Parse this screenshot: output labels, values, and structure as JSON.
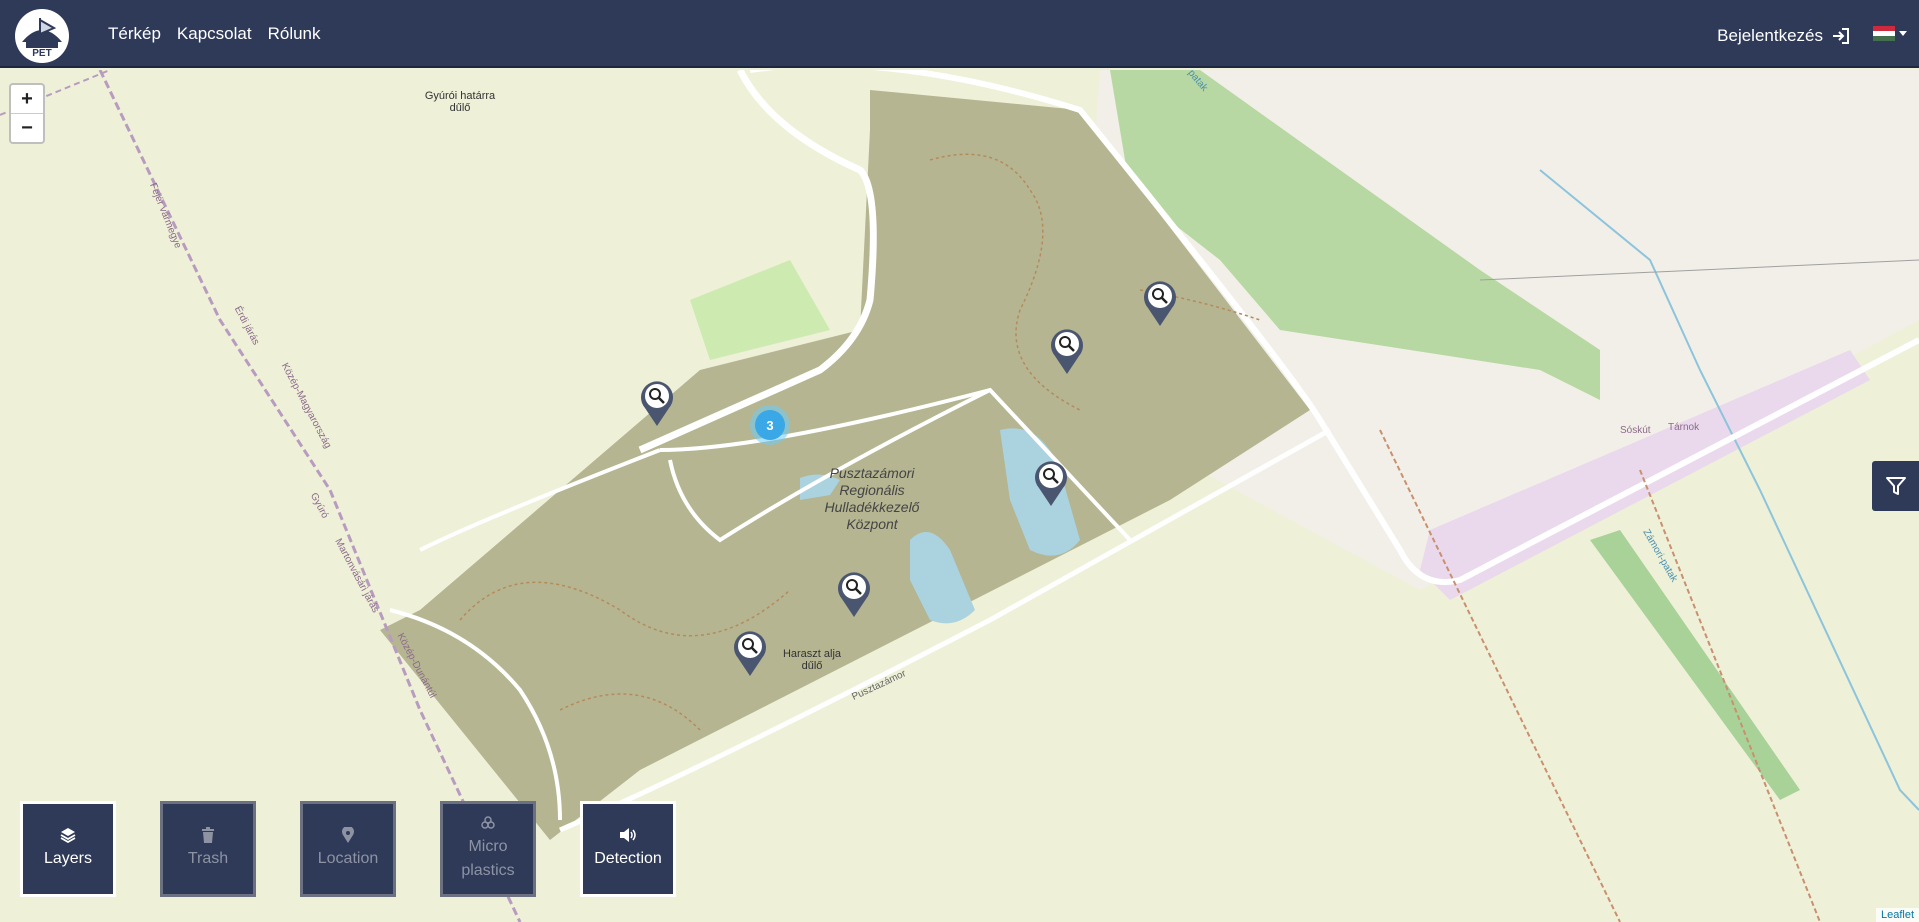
{
  "navbar": {
    "links": [
      "Térkép",
      "Kapcsolat",
      "Rólunk"
    ],
    "login_label": "Bejelentkezés",
    "language_flag": "hungarian-flag-icon",
    "bg_color": "#2e3a58"
  },
  "map": {
    "zoom_in": "+",
    "zoom_out": "−",
    "cluster_count": "3",
    "labels": {
      "gyuroi": "Gyúrói határra dűlő",
      "center": "Pusztazámori Regionális Hulladékkezelő Központ",
      "haraszt": "Haraszt alja dűlő",
      "soskut": "Sóskút",
      "tarnok": "Tárnok",
      "zamori_patak": "Zámori-patak",
      "pusztazamor": "Pusztazámor",
      "fejer": "Fejér vármegye",
      "erdi": "Érdi járás",
      "kozep": "Közép-Magyarország",
      "gyuro": "Gyúró",
      "martonvasari": "Martonvásári járás",
      "kozep_dunantul": "Közép-Dunántúl",
      "patak_top": "patak"
    },
    "attribution": "Leaflet",
    "filter_icon": "filter-icon",
    "marker_icon": "magnifier-pin-icon"
  },
  "toolbar": {
    "buttons": [
      {
        "label": "Layers",
        "icon": "layers-icon",
        "state": "active"
      },
      {
        "label": "Trash",
        "icon": "trash-icon",
        "state": "disabled"
      },
      {
        "label": "Location",
        "icon": "location-pin-icon",
        "state": "disabled"
      },
      {
        "label": "Micro plastics",
        "icon": "biohazard-icon",
        "state": "disabled"
      },
      {
        "label": "Detection",
        "icon": "speaker-icon",
        "state": "active"
      }
    ]
  }
}
